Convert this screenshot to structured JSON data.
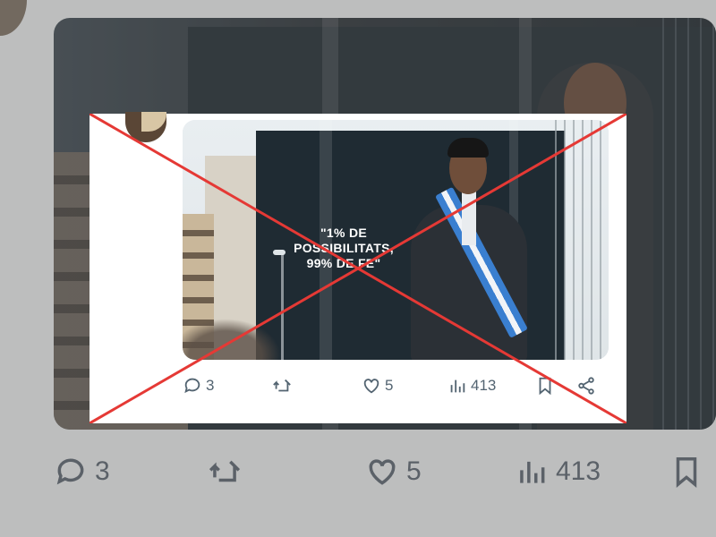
{
  "photo": {
    "slogan_line1": "\"1% DE POSSIBILITATS,",
    "slogan_line2": "99% DE FE\""
  },
  "card_actions": {
    "reply_count": "3",
    "like_count": "5",
    "views_count": "413"
  },
  "bg_actions": {
    "reply_count": "3",
    "like_count": "5",
    "views_count": "413"
  },
  "icons": [
    "reply-icon",
    "retweet-icon",
    "like-icon",
    "views-icon",
    "bookmark-icon",
    "share-icon"
  ],
  "colors": {
    "strike_red": "#e53935",
    "action_gray": "#536471"
  }
}
